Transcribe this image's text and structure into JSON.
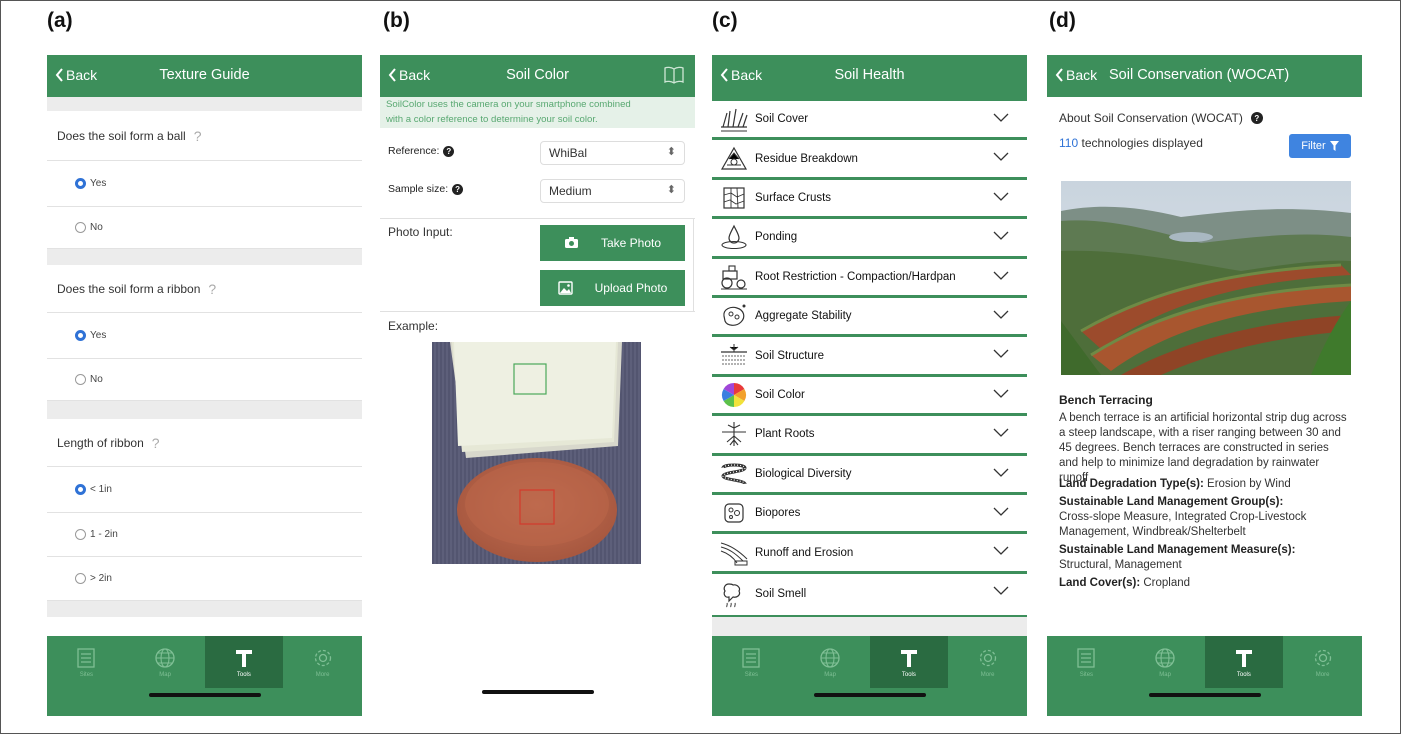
{
  "panel_labels": [
    "(a)",
    "(b)",
    "(c)",
    "(d)"
  ],
  "colors": {
    "primary_green": "#3d8f5b",
    "tab_active": "#2a6b41",
    "link_blue": "#2f72d6"
  },
  "nav": {
    "back_label": "Back",
    "tabs": [
      {
        "label": "Sites",
        "icon": "list-icon"
      },
      {
        "label": "Map",
        "icon": "globe-icon"
      },
      {
        "label": "Tools",
        "icon": "hammer-icon"
      },
      {
        "label": "More",
        "icon": "gear-icon"
      }
    ]
  },
  "texture": {
    "title": "Texture Guide",
    "questions": [
      {
        "text": "Does the soil form a ball",
        "options": [
          {
            "label": "Yes",
            "selected": true
          },
          {
            "label": "No",
            "selected": false
          }
        ]
      },
      {
        "text": "Does the soil form a ribbon",
        "options": [
          {
            "label": "Yes",
            "selected": true
          },
          {
            "label": "No",
            "selected": false
          }
        ]
      },
      {
        "text": "Length of ribbon",
        "options": [
          {
            "label": "< 1in",
            "selected": true
          },
          {
            "label": "1 - 2in",
            "selected": false
          },
          {
            "label": "> 2in",
            "selected": false
          }
        ]
      }
    ]
  },
  "soil_color": {
    "title": "Soil Color",
    "info_line1": "SoilColor uses the camera on your smartphone combined",
    "info_line2": "with a color reference to determine your soil color.",
    "reference_label": "Reference:",
    "reference_value": "WhiBal",
    "sample_size_label": "Sample size:",
    "sample_size_value": "Medium",
    "photo_input_label": "Photo Input:",
    "take_photo": "Take Photo",
    "upload_photo": "Upload Photo",
    "example_label": "Example:"
  },
  "soil_health": {
    "title": "Soil Health",
    "items": [
      {
        "label": "Soil Cover",
        "icon": "grass-icon"
      },
      {
        "label": "Residue Breakdown",
        "icon": "recycle-icon"
      },
      {
        "label": "Surface Crusts",
        "icon": "crust-icon"
      },
      {
        "label": "Ponding",
        "icon": "water-drop-icon"
      },
      {
        "label": "Root Restriction - Compaction/Hardpan",
        "icon": "tractor-icon"
      },
      {
        "label": "Aggregate Stability",
        "icon": "aggregate-icon"
      },
      {
        "label": "Soil Structure",
        "icon": "soil-structure-icon"
      },
      {
        "label": "Soil Color",
        "icon": "color-wheel-icon"
      },
      {
        "label": "Plant Roots",
        "icon": "roots-icon"
      },
      {
        "label": "Biological Diversity",
        "icon": "worm-icon"
      },
      {
        "label": "Biopores",
        "icon": "biopores-icon"
      },
      {
        "label": "Runoff and Erosion",
        "icon": "runoff-icon"
      },
      {
        "label": "Soil Smell",
        "icon": "smell-icon"
      }
    ]
  },
  "wocat": {
    "title": "Soil Conservation (WOCAT)",
    "about": "About Soil Conservation (WOCAT)",
    "count": "110",
    "count_suffix": "technologies displayed",
    "filter_label": "Filter",
    "tech_title": "Bench Terracing",
    "tech_desc": "A bench terrace is an artificial horizontal strip dug across a steep landscape, with a riser ranging between 30 and 45 degrees. Bench terraces are constructed in series and help to minimize land degradation by rainwater runoff",
    "degradation_label": "Land Degradation Type(s):",
    "degradation_value": "Erosion by Wind",
    "slm_group_label": "Sustainable Land Management Group(s):",
    "slm_group_value": "Cross-slope Measure, Integrated Crop-Livestock Management, Windbreak/Shelterbelt",
    "slm_measure_label": "Sustainable Land Management Measure(s):",
    "slm_measure_value": "Structural, Management",
    "land_cover_label": "Land Cover(s):",
    "land_cover_value": "Cropland"
  }
}
